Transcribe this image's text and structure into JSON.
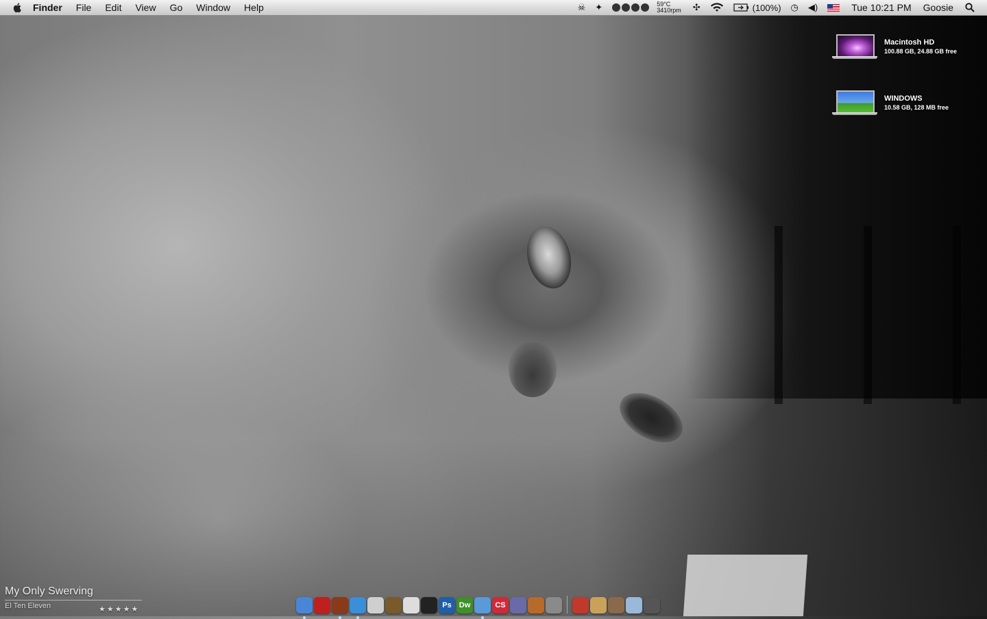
{
  "menubar": {
    "app_name": "Finder",
    "menus": [
      "File",
      "Edit",
      "View",
      "Go",
      "Window",
      "Help"
    ],
    "status": {
      "temperature": "59°C",
      "fan_speed": "3410rpm",
      "battery": "(100%)",
      "clock": "Tue 10:21 PM",
      "user": "Goosie"
    }
  },
  "desktop": {
    "disks": [
      {
        "name": "Macintosh HD",
        "info": "100.88 GB, 24.88 GB free"
      },
      {
        "name": "WINDOWS",
        "info": "10.58 GB, 128 MB free"
      }
    ]
  },
  "now_playing": {
    "song": "My Only Swerving",
    "artist": "El Ten Eleven",
    "rating": "★★★★★"
  },
  "dock": {
    "apps": [
      {
        "icon": "finder-icon",
        "color": "#4a86d8",
        "running": true
      },
      {
        "icon": "red-app-icon",
        "color": "#c01f1f",
        "running": false
      },
      {
        "icon": "dictionary-icon",
        "color": "#8a3a1a",
        "running": true
      },
      {
        "icon": "safari-icon",
        "color": "#3b8ed8",
        "running": true
      },
      {
        "icon": "address-book-icon",
        "color": "#cfcfcf",
        "running": false
      },
      {
        "icon": "iphoto-icon",
        "color": "#7a5a2a",
        "running": false
      },
      {
        "icon": "flickr-uploader-icon",
        "color": "#dddddd",
        "running": false
      },
      {
        "icon": "aperture-icon",
        "color": "#222222",
        "running": false
      },
      {
        "icon": "photoshop-icon",
        "color": "#1f5fa8",
        "running": false
      },
      {
        "icon": "dreamweaver-icon",
        "color": "#3f8f2a",
        "running": false
      },
      {
        "icon": "itunes-icon",
        "color": "#5a9ad8",
        "running": true
      },
      {
        "icon": "adobe-cs-icon",
        "color": "#d02a3a",
        "running": false
      },
      {
        "icon": "script-editor-icon",
        "color": "#6a6aa8",
        "running": false
      },
      {
        "icon": "keynote-icon",
        "color": "#b86a2a",
        "running": false
      },
      {
        "icon": "system-preferences-icon",
        "color": "#8a8a8a",
        "running": false
      }
    ],
    "stacks": [
      {
        "icon": "applications-stack-icon",
        "color": "#c0392b"
      },
      {
        "icon": "documents-stack-icon",
        "color": "#c9a25a"
      },
      {
        "icon": "downloads-stack-icon",
        "color": "#8a6a4a"
      },
      {
        "icon": "folder-stack-icon",
        "color": "#9ab8d8"
      },
      {
        "icon": "trash-icon",
        "color": "#555555"
      }
    ],
    "labels": {
      "photoshop": "Ps",
      "dreamweaver": "Dw",
      "adobe_cs": "CS"
    }
  }
}
